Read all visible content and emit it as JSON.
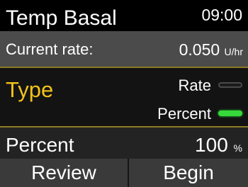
{
  "header": {
    "title": "Temp Basal",
    "time": "09:00"
  },
  "current_rate": {
    "label": "Current rate:",
    "value": "0.050",
    "unit": "U/hr"
  },
  "type_section": {
    "label": "Type",
    "options": [
      {
        "label": "Rate",
        "selected": false
      },
      {
        "label": "Percent",
        "selected": true
      }
    ]
  },
  "percent": {
    "label": "Percent",
    "value": "100",
    "unit": "%"
  },
  "buttons": {
    "review": "Review",
    "begin": "Begin"
  },
  "colors": {
    "accent_yellow": "#f3c21a",
    "toggle_on": "#35d93a"
  }
}
